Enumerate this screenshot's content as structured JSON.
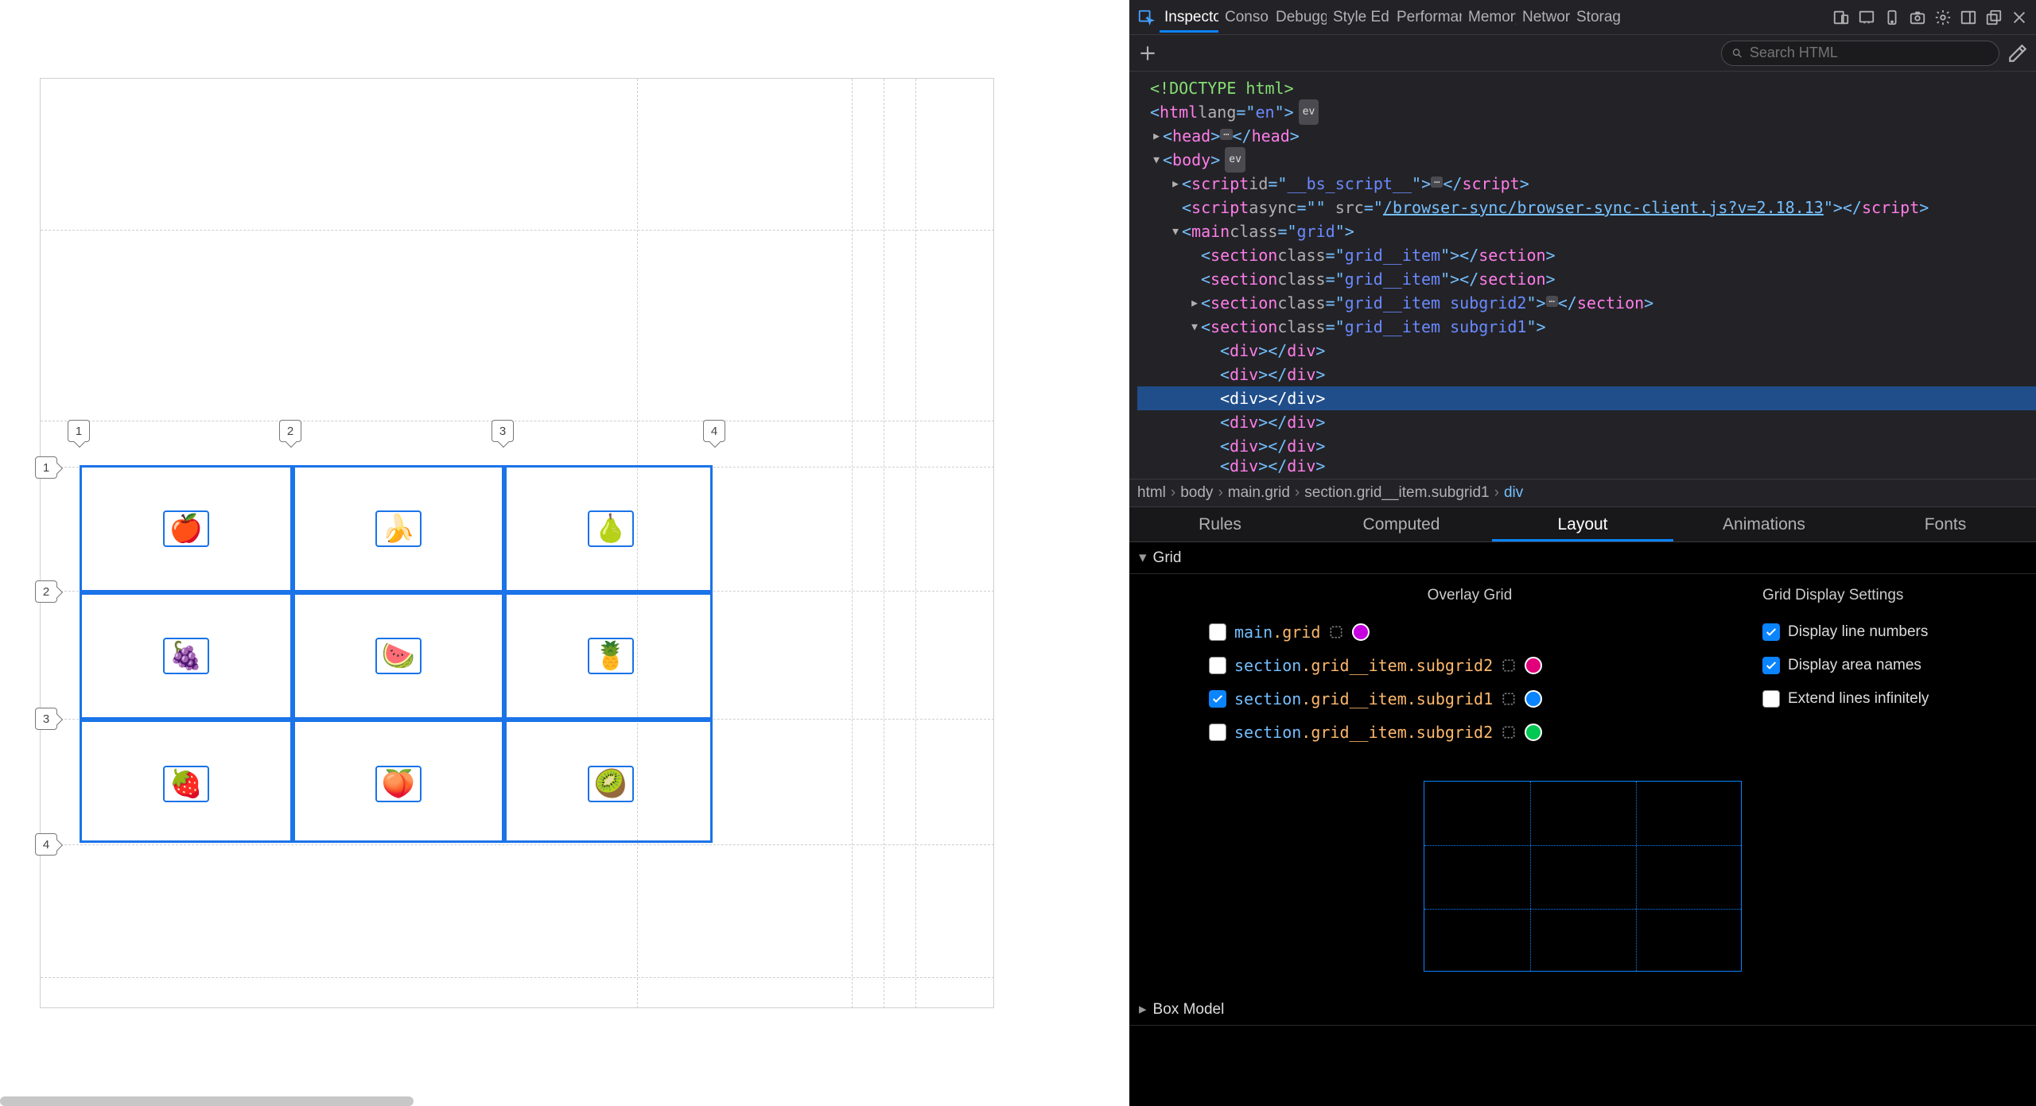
{
  "preview": {
    "grid_items": [
      "🍎",
      "🍌",
      "🍐",
      "🍇",
      "🍉",
      "🍍",
      "🍓",
      "🍑",
      "🥝"
    ],
    "col_lines": [
      "1",
      "2",
      "3",
      "4"
    ],
    "row_lines": [
      "1",
      "2",
      "3",
      "4"
    ]
  },
  "toolbar": {
    "tabs": [
      "Inspector",
      "Console",
      "Debugger",
      "Style Editor",
      "Performance",
      "Memory",
      "Network",
      "Storage"
    ],
    "active_tab": 0
  },
  "search": {
    "placeholder": "Search HTML"
  },
  "markup": {
    "doctype": "<!DOCTYPE html>",
    "html_open": {
      "tag": "html",
      "attr": "lang",
      "val": "en"
    },
    "head": "head",
    "body": "body",
    "script1": {
      "tag": "script",
      "attr_id": "id",
      "val_id": "__bs_script__"
    },
    "script2": {
      "tag": "script",
      "attr1": "async",
      "val1": "",
      "attr2": "src",
      "val2": "/browser-sync/browser-sync-client.js?v=2.18.13"
    },
    "main": {
      "tag": "main",
      "attr": "class",
      "val": "grid"
    },
    "section_a": {
      "tag": "section",
      "attr": "class",
      "val": "grid__item"
    },
    "section_b": {
      "tag": "section",
      "attr": "class",
      "val": "grid__item"
    },
    "section_c": {
      "tag": "section",
      "attr": "class",
      "val": "grid__item subgrid2"
    },
    "section_d": {
      "tag": "section",
      "attr": "class",
      "val": "grid__item subgrid1"
    },
    "div": "div"
  },
  "crumbs": [
    "html",
    "body",
    "main.grid",
    "section.grid__item.subgrid1",
    "div"
  ],
  "subtabs": [
    "Rules",
    "Computed",
    "Layout",
    "Animations",
    "Fonts"
  ],
  "subtabs_active": 2,
  "layout": {
    "grid_header": "Grid",
    "overlay_title": "Overlay Grid",
    "settings_title": "Grid Display Settings",
    "overlays": [
      {
        "checked": false,
        "tag": "main",
        "cls": ".grid",
        "color": "#c700e0"
      },
      {
        "checked": false,
        "tag": "section",
        "cls": ".grid__item.subgrid2",
        "color": "#e1007a"
      },
      {
        "checked": true,
        "tag": "section",
        "cls": ".grid__item.subgrid1",
        "color": "#0a84ff"
      },
      {
        "checked": false,
        "tag": "section",
        "cls": ".grid__item.subgrid2",
        "color": "#00c853"
      }
    ],
    "settings": [
      {
        "checked": true,
        "label": "Display line numbers"
      },
      {
        "checked": true,
        "label": "Display area names"
      },
      {
        "checked": false,
        "label": "Extend lines infinitely"
      }
    ],
    "boxmodel_header": "Box Model"
  }
}
